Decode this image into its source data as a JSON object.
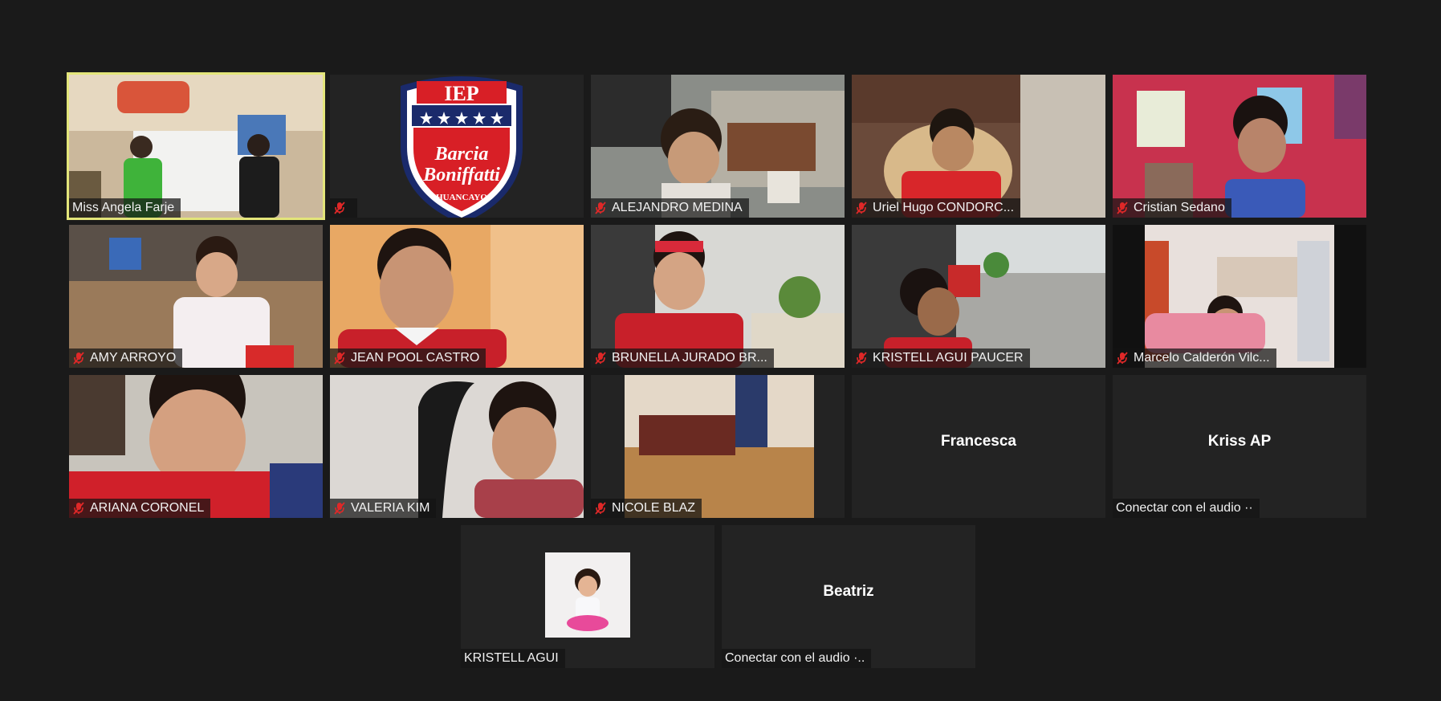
{
  "meeting": {
    "participants": [
      {
        "name": "Miss Angela Farje",
        "muted": false,
        "active": true
      },
      {
        "name": "",
        "muted": true,
        "logo": {
          "top": "IEP",
          "line1": "Barcia",
          "line2": "Boniffatti",
          "city": "HUANCAYO"
        }
      },
      {
        "name": "ALEJANDRO MEDINA",
        "muted": true
      },
      {
        "name": "Uriel Hugo CONDORC...",
        "muted": true
      },
      {
        "name": "Cristian Sedano",
        "muted": true
      },
      {
        "name": "AMY ARROYO",
        "muted": true
      },
      {
        "name": "JEAN POOL CASTRO",
        "muted": true
      },
      {
        "name": "BRUNELLA JURADO BR...",
        "muted": true
      },
      {
        "name": "KRISTELL AGUI PAUCER",
        "muted": true
      },
      {
        "name": "Marcelo Calderón Vilc...",
        "muted": true
      },
      {
        "name": "ARIANA CORONEL",
        "muted": true
      },
      {
        "name": "VALERIA KIM",
        "muted": true
      },
      {
        "name": "NICOLE BLAZ",
        "muted": true
      },
      {
        "center": "Francesca"
      },
      {
        "center": "Kriss AP",
        "plate": "Conectar con el audio ··"
      },
      {
        "name": "KRISTELL AGUI",
        "muted": false,
        "avatar": true
      },
      {
        "center": "Beatriz",
        "plate": "Conectar con el audio ·.."
      }
    ]
  }
}
